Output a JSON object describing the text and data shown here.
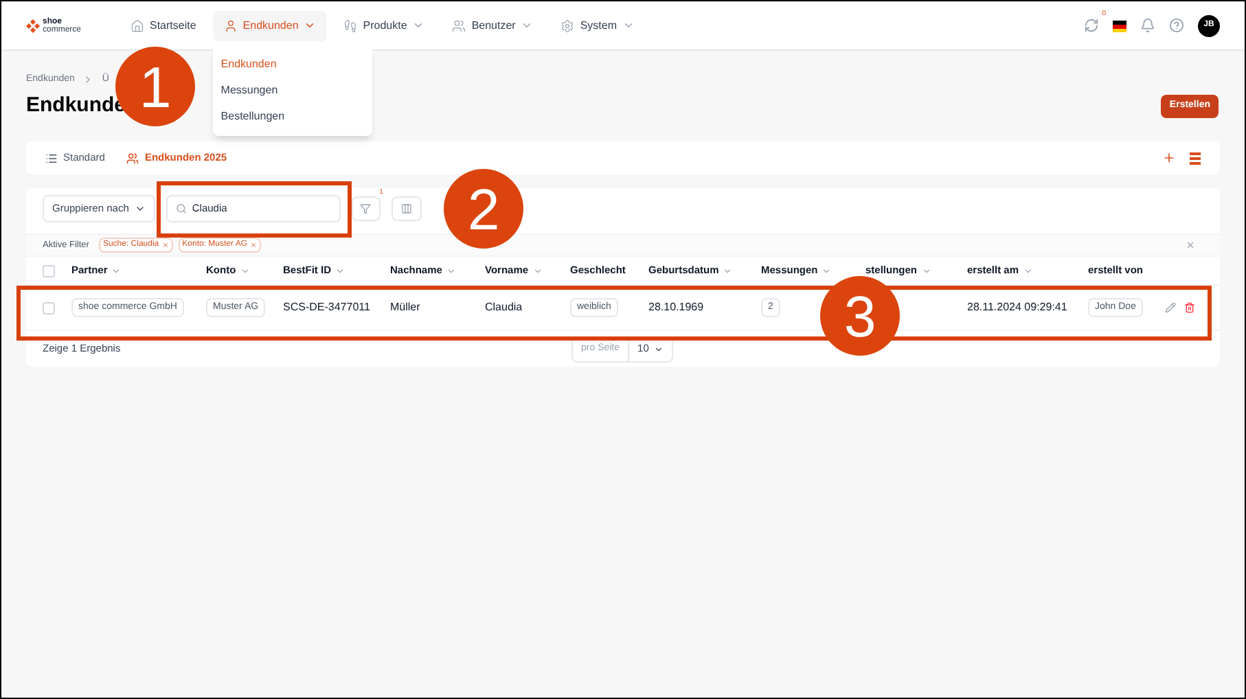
{
  "logo": {
    "line1": "shoe",
    "line2": "commerce"
  },
  "nav": [
    {
      "label": "Startseite",
      "selected": false,
      "dropdown": false
    },
    {
      "label": "Endkunden",
      "selected": true,
      "dropdown": true
    },
    {
      "label": "Produkte",
      "selected": false,
      "dropdown": true
    },
    {
      "label": "Benutzer",
      "selected": false,
      "dropdown": true
    },
    {
      "label": "System",
      "selected": false,
      "dropdown": true
    }
  ],
  "nav_menu": [
    {
      "label": "Endkunden",
      "selected": true
    },
    {
      "label": "Messungen",
      "selected": false
    },
    {
      "label": "Bestellungen",
      "selected": false
    }
  ],
  "header_tools": {
    "sync_count": "0",
    "avatar": "JB"
  },
  "breadcrumb": [
    "Endkunden",
    "Ü"
  ],
  "title": "Endkunde",
  "create_button": "Erstellen",
  "views": [
    {
      "label": "Standard",
      "selected": false
    },
    {
      "label": "Endkunden 2025",
      "selected": true
    }
  ],
  "toolbar": {
    "group_by": "Gruppieren nach",
    "search_value": "Claudia",
    "filter_count": "1"
  },
  "active_filters": {
    "label": "Aktive Filter",
    "chips": [
      "Suche: Claudia",
      "Konto: Muster AG"
    ]
  },
  "table": {
    "all_checked": false,
    "columns": [
      {
        "label": "Partner",
        "sortable": true
      },
      {
        "label": "Konto",
        "sortable": true
      },
      {
        "label": "BestFit ID",
        "sortable": true
      },
      {
        "label": "Nachname",
        "sortable": true
      },
      {
        "label": "Vorname",
        "sortable": true
      },
      {
        "label": "Geschlecht",
        "sortable": false
      },
      {
        "label": "Geburtsdatum",
        "sortable": true
      },
      {
        "label": "Messungen",
        "sortable": true
      },
      {
        "label": "stellungen",
        "sortable": true
      },
      {
        "label": "erstellt am",
        "sortable": true
      },
      {
        "label": "erstellt von",
        "sortable": false
      }
    ],
    "rows": [
      {
        "checked": false,
        "cells": [
          {
            "text": "shoe commerce GmbH",
            "kind": "tag"
          },
          {
            "text": "Muster AG",
            "kind": "tag"
          },
          {
            "text": "SCS-DE-3477011",
            "kind": "text"
          },
          {
            "text": "Müller",
            "kind": "text"
          },
          {
            "text": "Claudia",
            "kind": "text"
          },
          {
            "text": "weiblich",
            "kind": "tag"
          },
          {
            "text": "28.10.1969",
            "kind": "text"
          },
          {
            "text": "2",
            "kind": "tag"
          },
          {
            "kind": "empty"
          },
          {
            "text": "28.11.2024 09:29:41",
            "kind": "text"
          },
          {
            "text": "John Doe",
            "kind": "tag"
          }
        ]
      }
    ]
  },
  "footer": {
    "result": "Zeige 1 Ergebnis",
    "per_page_label": "pro Seite",
    "per_page": "10"
  },
  "callouts": [
    "1",
    "2",
    "3"
  ]
}
